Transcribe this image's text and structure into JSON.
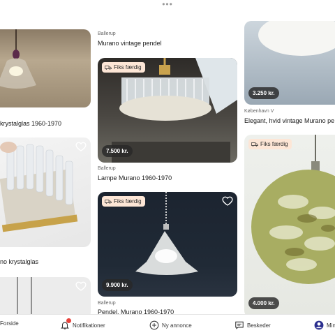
{
  "app": {
    "top_indicator": "•••"
  },
  "col1": {
    "items": [
      {
        "title": "krystalglas 1960-1970"
      },
      {
        "title": "no krystalglas"
      }
    ]
  },
  "col2": {
    "items": [
      {
        "location": "Ballerup",
        "title": "Murano vintage pendel"
      },
      {
        "badge": "Fiks færdig",
        "price": "7.500 kr.",
        "location": "Ballerup",
        "title": "Lampe Murano 1960-1970"
      },
      {
        "badge": "Fiks færdig",
        "price": "9.900 kr.",
        "location": "Ballerup",
        "title": "Pendel, Murano 1960-1970"
      }
    ]
  },
  "col3": {
    "items": [
      {
        "price": "3.250 kr.",
        "location": "København V",
        "title": "Elegant, hvid vintage Murano pe"
      },
      {
        "badge": "Fiks færdig",
        "price": "4.000 kr."
      }
    ]
  },
  "tabbar": {
    "items": [
      {
        "label": "Forside",
        "icon": "home-icon"
      },
      {
        "label": "Notifikationer",
        "icon": "bell-icon"
      },
      {
        "label": "Ny annonce",
        "icon": "plus-circle-icon"
      },
      {
        "label": "Beskeder",
        "icon": "chat-icon"
      },
      {
        "label": "Min",
        "icon": "profile-icon"
      }
    ]
  },
  "colors": {
    "badge_bg": "#fde6d6",
    "notification_dot": "#e8423b",
    "accent": "#2b2f8f"
  }
}
